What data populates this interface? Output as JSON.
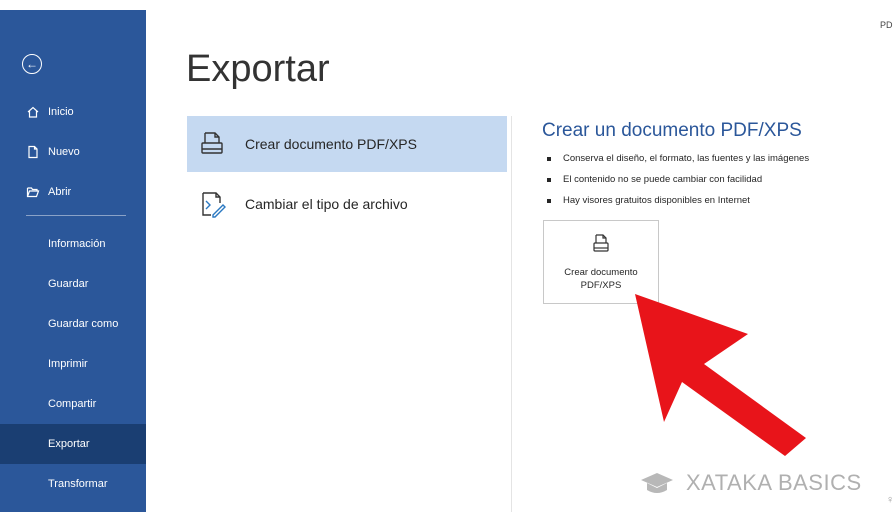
{
  "sidebar": {
    "back_icon": "arrow-left-circle-icon",
    "top_items": [
      {
        "label": "Inicio",
        "icon": "home-icon"
      },
      {
        "label": "Nuevo",
        "icon": "new-document-icon"
      },
      {
        "label": "Abrir",
        "icon": "folder-open-icon"
      }
    ],
    "bottom_items": [
      {
        "label": "Información"
      },
      {
        "label": "Guardar"
      },
      {
        "label": "Guardar como"
      },
      {
        "label": "Imprimir"
      },
      {
        "label": "Compartir"
      },
      {
        "label": "Exportar",
        "active": true
      },
      {
        "label": "Transformar"
      }
    ]
  },
  "main": {
    "title": "Exportar",
    "options": [
      {
        "label": "Crear documento PDF/XPS",
        "icon": "pdf-document-icon",
        "selected": true
      },
      {
        "label": "Cambiar el tipo de archivo",
        "icon": "change-file-type-icon",
        "selected": false
      }
    ],
    "detail": {
      "title": "Crear un documento PDF/XPS",
      "bullets": [
        "Conserva el diseño, el formato, las fuentes y las imágenes",
        "El contenido no se puede cambiar con facilidad",
        "Hay visores gratuitos disponibles en Internet"
      ],
      "button_label": "Crear documento PDF/XPS",
      "button_icon": "pdf-document-icon"
    }
  },
  "corner_text": "PD",
  "watermark": {
    "text": "XATAKA BASICS",
    "icon": "graduation-cap-icon"
  },
  "colors": {
    "sidebar": "#2b579a",
    "sidebar_active": "#1a3e72",
    "selected_option": "#c5d9f1",
    "accent_title": "#2b579a",
    "arrow": "#e8141a"
  }
}
